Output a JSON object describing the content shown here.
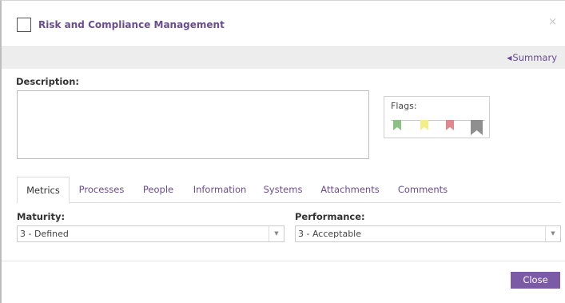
{
  "dialog": {
    "title": "Risk and Compliance Management",
    "close_glyph": "×"
  },
  "summary": {
    "caret_glyph": "◀",
    "label": "Summary"
  },
  "description": {
    "label": "Description:",
    "value": "",
    "placeholder": ""
  },
  "flags": {
    "label": "Flags:",
    "items": [
      {
        "name": "green-flag",
        "color": "#8cc084"
      },
      {
        "name": "yellow-flag",
        "color": "#f2ef8a"
      },
      {
        "name": "red-flag",
        "color": "#e0878f"
      },
      {
        "name": "gray-flag",
        "color": "#8f8f8f"
      }
    ]
  },
  "tabs": [
    {
      "label": "Metrics",
      "active": true
    },
    {
      "label": "Processes",
      "active": false
    },
    {
      "label": "People",
      "active": false
    },
    {
      "label": "Information",
      "active": false
    },
    {
      "label": "Systems",
      "active": false
    },
    {
      "label": "Attachments",
      "active": false
    },
    {
      "label": "Comments",
      "active": false
    }
  ],
  "metrics": {
    "maturity": {
      "label": "Maturity:",
      "value": "3 - Defined"
    },
    "performance": {
      "label": "Performance:",
      "value": "3 - Acceptable"
    }
  },
  "footer": {
    "close_label": "Close"
  },
  "colors": {
    "accent": "#6a4c93",
    "button": "#7b5aa6"
  }
}
